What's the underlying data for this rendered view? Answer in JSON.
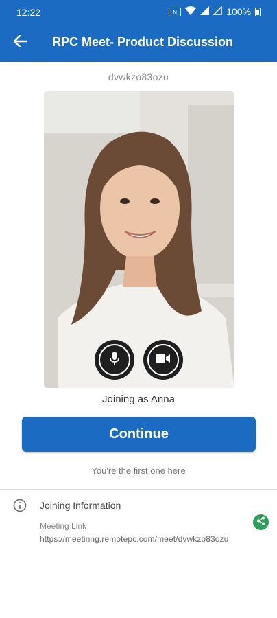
{
  "status_bar": {
    "time": "12:22",
    "battery": "100%",
    "icons": [
      "nfc-icon",
      "wifi-icon",
      "signal-icon",
      "signal-empty-icon",
      "battery-icon"
    ]
  },
  "header": {
    "title": "RPC Meet- Product Discussion",
    "back_icon": "arrow-left-icon",
    "color": "#1a6bc1"
  },
  "meeting": {
    "id": "dvwkzo83ozu"
  },
  "controls": {
    "mic_icon": "microphone-icon",
    "camera_icon": "video-camera-icon"
  },
  "joining_as": "Joining as Anna",
  "continue_label": "Continue",
  "status_text": "You're the first one here",
  "info": {
    "title": "Joining Information",
    "link_label": "Meeting Link",
    "link_url": "https://meetinng.remotepc.com/meet/dvwkzo83ozu",
    "share_icon": "share-icon",
    "share_color": "#2e9d5b"
  }
}
